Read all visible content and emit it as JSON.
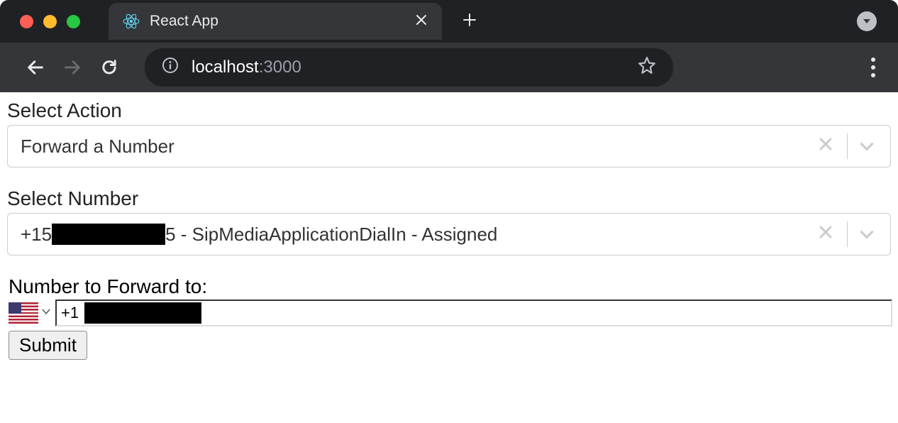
{
  "browser": {
    "tab_title": "React App",
    "url_host": "localhost",
    "url_port": ":3000"
  },
  "form": {
    "action": {
      "label": "Select Action",
      "selected": "Forward a Number"
    },
    "number": {
      "label": "Select Number",
      "selected_prefix": "+15",
      "selected_suffix": "5 - SipMediaApplicationDialIn - Assigned"
    },
    "forward": {
      "label": "Number to Forward to:",
      "country_prefix": "+1"
    },
    "submit_label": "Submit"
  }
}
